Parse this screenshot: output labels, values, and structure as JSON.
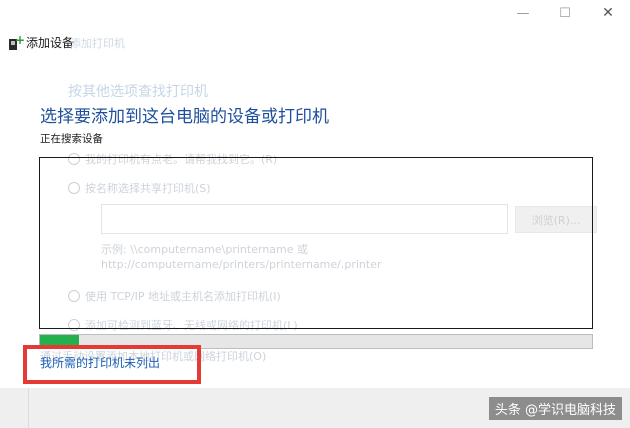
{
  "window": {
    "minimize_glyph": "—",
    "maximize_glyph": "☐",
    "close_glyph": "✕",
    "app_title": "添加设备"
  },
  "background_wizard": {
    "back_title": "添加打印机",
    "heading": "按其他选项查找打印机",
    "option1": "我的打印机有点老。请帮我找到它。(R)",
    "option2": "按名称选择共享打印机(S)",
    "browse_button": "浏览(R)...",
    "example_line1": "示例: \\\\computername\\printername 或",
    "example_line2": "http://computername/printers/printername/.printer",
    "option3": "使用 TCP/IP 地址或主机名添加打印机(I)",
    "option4": "添加可检测到蓝牙、无线或网络的打印机(L)",
    "option5": "通过手动设置添加本地打印机或网络打印机(O)"
  },
  "main": {
    "title": "选择要添加到这台电脑的设备或打印机",
    "status": "正在搜索设备",
    "progress": 0.07,
    "not_listed_link": "我所需的打印机未列出"
  },
  "watermark": "头条 @学识电脑科技",
  "colors": {
    "title": "#1e4e9c",
    "link": "#1a5fb4",
    "progress": "#22b14c",
    "highlight": "#e53935"
  }
}
